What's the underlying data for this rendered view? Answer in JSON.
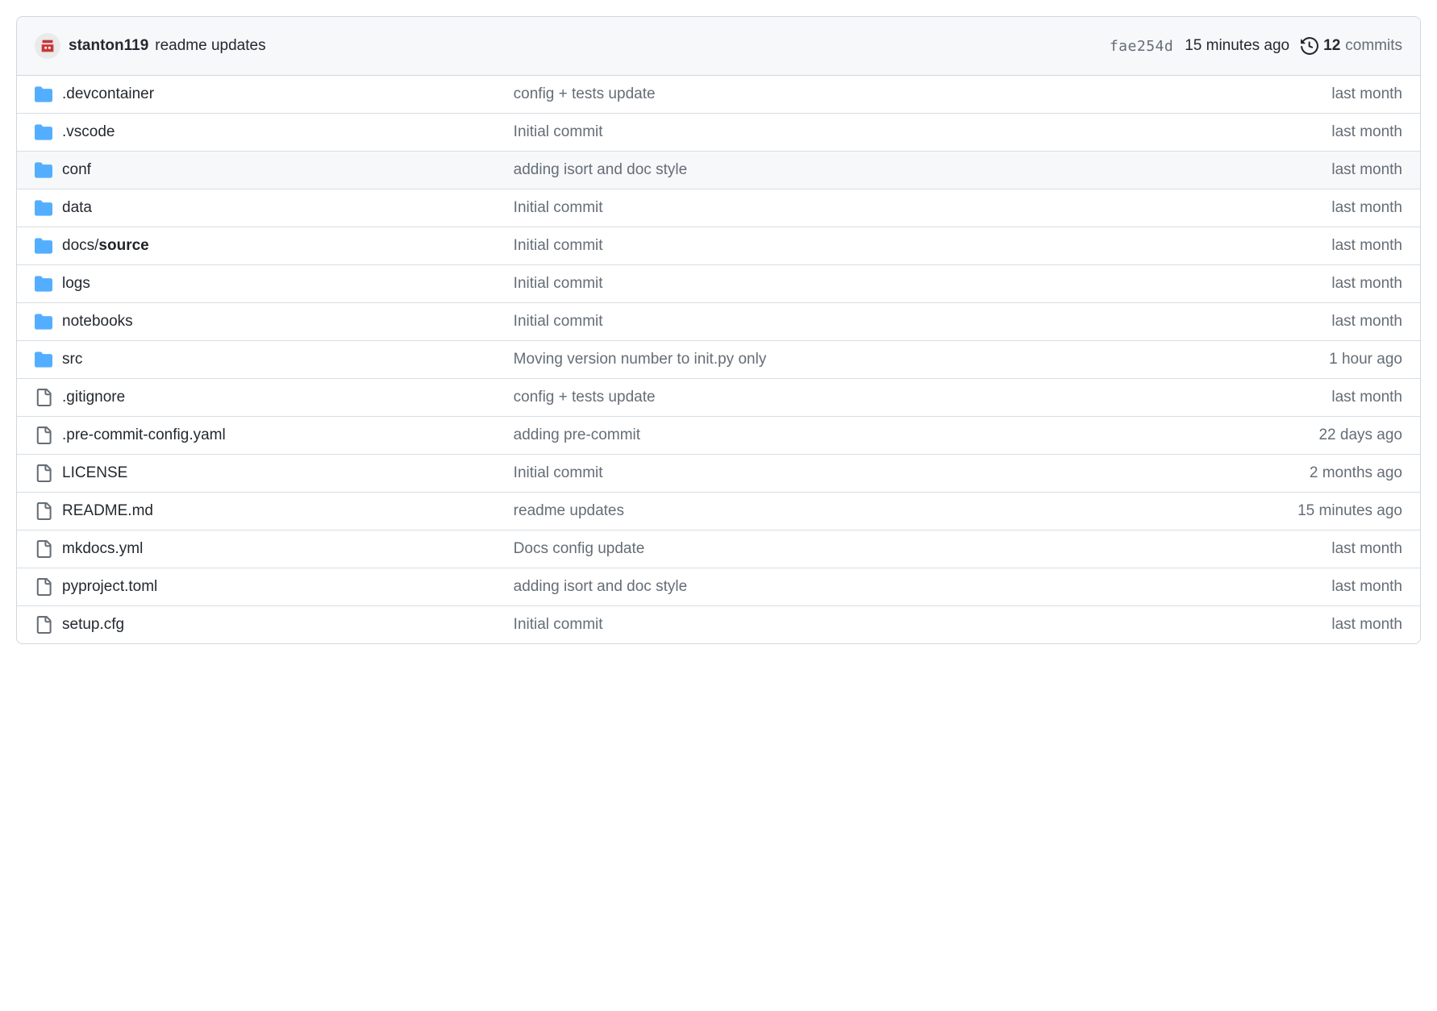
{
  "header": {
    "author": "stanton119",
    "message": "readme updates",
    "sha": "fae254d",
    "time": "15 minutes ago",
    "commits_count": "12",
    "commits_label": "commits"
  },
  "files": [
    {
      "type": "dir",
      "name_prefix": "",
      "name": ".devcontainer",
      "message": "config + tests update",
      "time": "last month",
      "hover": false
    },
    {
      "type": "dir",
      "name_prefix": "",
      "name": ".vscode",
      "message": "Initial commit",
      "time": "last month",
      "hover": false
    },
    {
      "type": "dir",
      "name_prefix": "",
      "name": "conf",
      "message": "adding isort and doc style",
      "time": "last month",
      "hover": true
    },
    {
      "type": "dir",
      "name_prefix": "",
      "name": "data",
      "message": "Initial commit",
      "time": "last month",
      "hover": false
    },
    {
      "type": "dir",
      "name_prefix": "docs/",
      "name": "source",
      "message": "Initial commit",
      "time": "last month",
      "hover": false
    },
    {
      "type": "dir",
      "name_prefix": "",
      "name": "logs",
      "message": "Initial commit",
      "time": "last month",
      "hover": false
    },
    {
      "type": "dir",
      "name_prefix": "",
      "name": "notebooks",
      "message": "Initial commit",
      "time": "last month",
      "hover": false
    },
    {
      "type": "dir",
      "name_prefix": "",
      "name": "src",
      "message": "Moving version number to init.py only",
      "time": "1 hour ago",
      "hover": false
    },
    {
      "type": "file",
      "name_prefix": "",
      "name": ".gitignore",
      "message": "config + tests update",
      "time": "last month",
      "hover": false
    },
    {
      "type": "file",
      "name_prefix": "",
      "name": ".pre-commit-config.yaml",
      "message": "adding pre-commit",
      "time": "22 days ago",
      "hover": false
    },
    {
      "type": "file",
      "name_prefix": "",
      "name": "LICENSE",
      "message": "Initial commit",
      "time": "2 months ago",
      "hover": false
    },
    {
      "type": "file",
      "name_prefix": "",
      "name": "README.md",
      "message": "readme updates",
      "time": "15 minutes ago",
      "hover": false
    },
    {
      "type": "file",
      "name_prefix": "",
      "name": "mkdocs.yml",
      "message": "Docs config update",
      "time": "last month",
      "hover": false
    },
    {
      "type": "file",
      "name_prefix": "",
      "name": "pyproject.toml",
      "message": "adding isort and doc style",
      "time": "last month",
      "hover": false
    },
    {
      "type": "file",
      "name_prefix": "",
      "name": "setup.cfg",
      "message": "Initial commit",
      "time": "last month",
      "hover": false
    }
  ]
}
